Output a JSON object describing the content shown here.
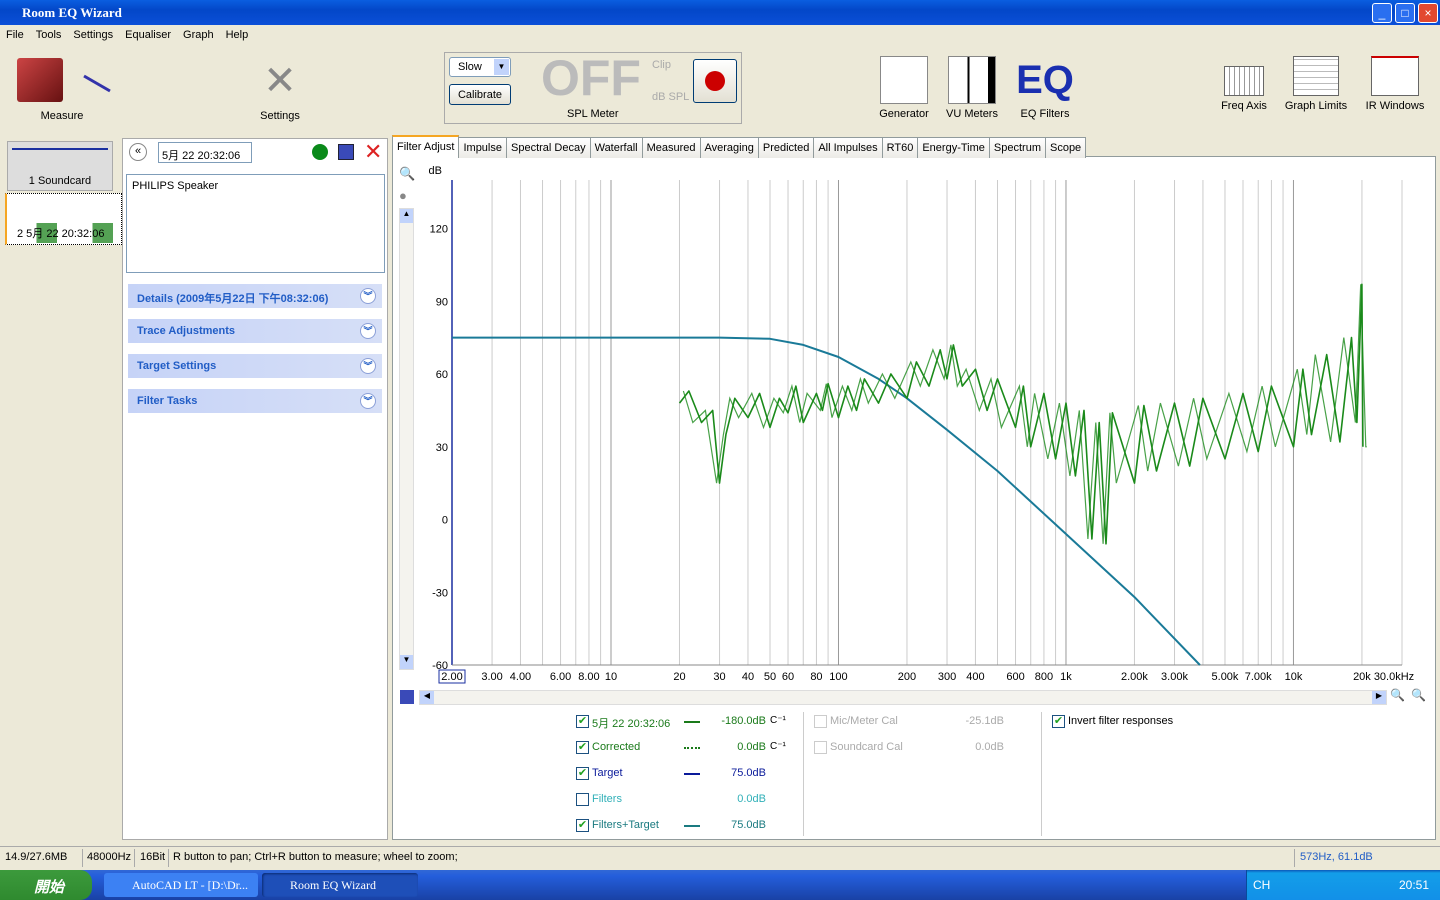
{
  "window": {
    "title": "Room EQ Wizard",
    "min": "_",
    "max": "□",
    "close": "×"
  },
  "menu": [
    "File",
    "Tools",
    "Settings",
    "Equaliser",
    "Graph",
    "Help"
  ],
  "toolbar": {
    "measure": "Measure",
    "settings": "Settings",
    "spl": {
      "speed": "Slow",
      "calibrate": "Calibrate",
      "state": "OFF",
      "clip": "Clip",
      "unit": "dB SPL",
      "label": "SPL Meter"
    },
    "generator": "Generator",
    "vu": "VU Meters",
    "eq": "EQ Filters",
    "freq_axis": "Freq Axis",
    "graph_limits": "Graph Limits",
    "ir_windows": "IR Windows",
    "eq_logo": "EQ"
  },
  "measurements": [
    {
      "label": "1 Soundcard"
    },
    {
      "label": "2 5月 22 20:32:06"
    }
  ],
  "panel": {
    "name": "5月 22 20:32:06",
    "notes": "PHILIPS Speaker",
    "sections": [
      "Details  (2009年5月22日 下午08:32:06)",
      "Trace Adjustments",
      "Target Settings",
      "Filter Tasks"
    ]
  },
  "tabs": [
    "Filter Adjust",
    "Impulse",
    "Spectral Decay",
    "Waterfall",
    "Measured",
    "Averaging",
    "Predicted",
    "All Impulses",
    "RT60",
    "Energy-Time",
    "Spectrum",
    "Scope"
  ],
  "active_tab": "Filter Adjust",
  "legend": {
    "traces": [
      {
        "label": "5月 22 20:32:06",
        "checked": true,
        "value": "-180.0dB",
        "color": "#1a7a1a",
        "line": "solid",
        "extra": "C⁻¹"
      },
      {
        "label": "Corrected",
        "checked": true,
        "value": "0.0dB",
        "color": "#1a7a1a",
        "line": "dotted",
        "extra": "C⁻¹"
      },
      {
        "label": "Target",
        "checked": true,
        "value": "75.0dB",
        "color": "#0a1a9a",
        "line": "solid",
        "extra": ""
      },
      {
        "label": "Filters",
        "checked": false,
        "value": "0.0dB",
        "color": "#30b0b8",
        "line": "none",
        "extra": ""
      },
      {
        "label": "Filters+Target",
        "checked": true,
        "value": "75.0dB",
        "color": "#1a7a80",
        "line": "solid",
        "extra": ""
      }
    ],
    "cal": [
      {
        "label": "Mic/Meter Cal",
        "value": "-25.1dB"
      },
      {
        "label": "Soundcard Cal",
        "value": "0.0dB"
      }
    ],
    "invert": {
      "label": "Invert filter responses",
      "checked": true
    }
  },
  "status": {
    "memory": "14.9/27.6MB",
    "rate": "48000Hz",
    "bits": "16Bit",
    "hint": "R button to pan; Ctrl+R button to measure; wheel to zoom;",
    "cursor": "573Hz, 61.1dB"
  },
  "taskbar": {
    "start": "開始",
    "tasks": [
      "AutoCAD LT - [D:\\Dr...",
      "Room EQ Wizard"
    ],
    "lang": "CH",
    "clock": "20:51"
  },
  "chart_data": {
    "type": "line",
    "ylabel": "dB",
    "xscale": "log",
    "xlim": [
      2,
      30000
    ],
    "ylim": [
      -60,
      140
    ],
    "grid": "vertical only",
    "yticks": [
      120,
      90,
      60,
      30,
      0,
      -30,
      -60
    ],
    "xticks": [
      [
        2,
        "2.00"
      ],
      [
        3,
        "3.00"
      ],
      [
        4,
        "4.00"
      ],
      [
        6,
        "6.00"
      ],
      [
        8,
        "8.00"
      ],
      [
        10,
        "10"
      ],
      [
        20,
        "20"
      ],
      [
        30,
        "30"
      ],
      [
        40,
        "40"
      ],
      [
        50,
        "50"
      ],
      [
        60,
        "60"
      ],
      [
        80,
        "80"
      ],
      [
        100,
        "100"
      ],
      [
        200,
        "200"
      ],
      [
        300,
        "300"
      ],
      [
        400,
        "400"
      ],
      [
        600,
        "600"
      ],
      [
        800,
        "800"
      ],
      [
        1000,
        "1k"
      ],
      [
        2000,
        "2.00k"
      ],
      [
        3000,
        "3.00k"
      ],
      [
        5000,
        "5.00k"
      ],
      [
        7000,
        "7.00k"
      ],
      [
        10000,
        "10k"
      ],
      [
        20000,
        "20k"
      ],
      [
        30000,
        "30.0kHz"
      ]
    ],
    "series": [
      {
        "name": "Filters+Target",
        "color": "#1a7a98",
        "points": [
          [
            2,
            75
          ],
          [
            10,
            75
          ],
          [
            30,
            75
          ],
          [
            50,
            74.5
          ],
          [
            70,
            72
          ],
          [
            100,
            67
          ],
          [
            150,
            58
          ],
          [
            200,
            50
          ],
          [
            300,
            37
          ],
          [
            500,
            20
          ],
          [
            1000,
            -6
          ],
          [
            2000,
            -32
          ],
          [
            3880,
            -60
          ]
        ]
      },
      {
        "name": "5月 22 20:32:06",
        "color": "#1a8a1a",
        "points": [
          [
            20,
            48
          ],
          [
            22,
            53
          ],
          [
            25,
            40
          ],
          [
            28,
            45
          ],
          [
            30,
            15
          ],
          [
            32,
            35
          ],
          [
            35,
            50
          ],
          [
            40,
            42
          ],
          [
            45,
            52
          ],
          [
            50,
            38
          ],
          [
            55,
            50
          ],
          [
            60,
            44
          ],
          [
            65,
            55
          ],
          [
            70,
            40
          ],
          [
            80,
            52
          ],
          [
            85,
            45
          ],
          [
            90,
            56
          ],
          [
            100,
            42
          ],
          [
            110,
            55
          ],
          [
            120,
            45
          ],
          [
            130,
            58
          ],
          [
            150,
            48
          ],
          [
            170,
            60
          ],
          [
            200,
            50
          ],
          [
            220,
            65
          ],
          [
            250,
            55
          ],
          [
            280,
            70
          ],
          [
            300,
            58
          ],
          [
            320,
            72
          ],
          [
            350,
            55
          ],
          [
            400,
            62
          ],
          [
            450,
            45
          ],
          [
            500,
            58
          ],
          [
            600,
            38
          ],
          [
            650,
            55
          ],
          [
            700,
            30
          ],
          [
            800,
            52
          ],
          [
            900,
            25
          ],
          [
            1000,
            48
          ],
          [
            1100,
            18
          ],
          [
            1200,
            45
          ],
          [
            1300,
            -8
          ],
          [
            1400,
            40
          ],
          [
            1500,
            -10
          ],
          [
            1600,
            44
          ],
          [
            2000,
            15
          ],
          [
            2200,
            47
          ],
          [
            2500,
            20
          ],
          [
            3000,
            48
          ],
          [
            3500,
            22
          ],
          [
            4000,
            50
          ],
          [
            5000,
            25
          ],
          [
            6000,
            52
          ],
          [
            7000,
            28
          ],
          [
            8000,
            55
          ],
          [
            10000,
            30
          ],
          [
            11000,
            62
          ],
          [
            12000,
            35
          ],
          [
            14000,
            68
          ],
          [
            16000,
            32
          ],
          [
            18000,
            75
          ],
          [
            19000,
            40
          ],
          [
            20000,
            97
          ],
          [
            20200,
            30
          ]
        ]
      }
    ]
  }
}
